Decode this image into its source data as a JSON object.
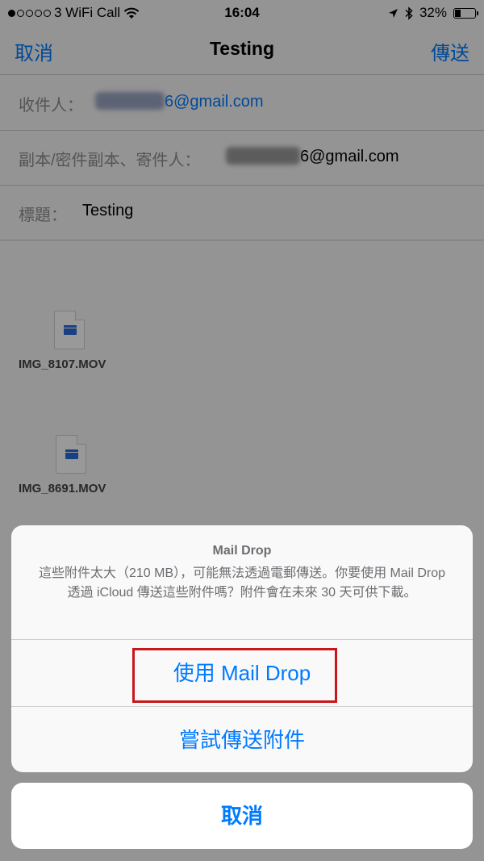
{
  "status": {
    "carrier": "3 WiFi Call",
    "time": "16:04",
    "battery": "32%",
    "battery_level": 0.32
  },
  "nav": {
    "cancel": "取消",
    "title": "Testing",
    "send": "傳送"
  },
  "fields": {
    "to_label": "收件人：",
    "to_value": "6@gmail.com",
    "cc_label": "副本/密件副本、寄件人：",
    "cc_value": "6@gmail.com",
    "subject_label": "標題：",
    "subject_value": "Testing"
  },
  "attachments": [
    {
      "name": "IMG_8107.MOV",
      "icon": "movie-file-icon"
    },
    {
      "name": "IMG_8691.MOV",
      "icon": "movie-file-icon"
    }
  ],
  "sheet": {
    "title": "Mail Drop",
    "message": "這些附件太大（210 MB），可能無法透過電郵傳送。你要使用 Mail Drop 透過 iCloud 傳送這些附件嗎？附件會在未來 30 天可供下載。",
    "use_mail_drop": "使用 Mail Drop",
    "try_send": "嘗試傳送附件",
    "cancel": "取消"
  },
  "colors": {
    "accent": "#007aff",
    "highlight": "#c8161d"
  }
}
